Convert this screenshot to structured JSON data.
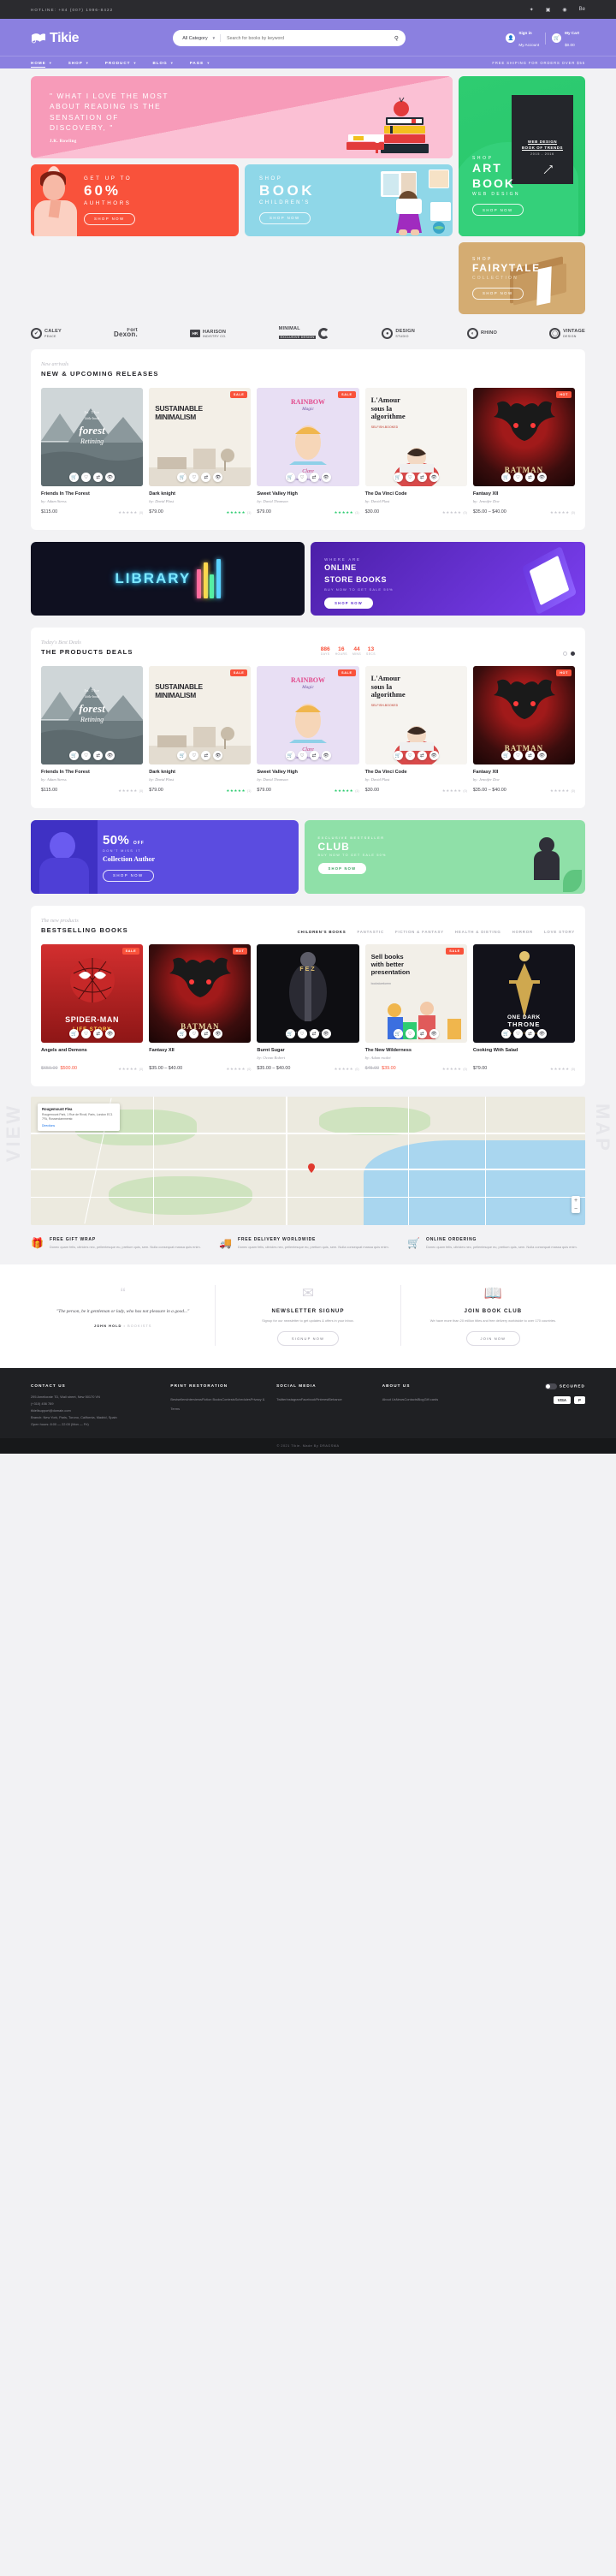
{
  "topbar": {
    "hotline": "HOTLINE: +84 (007) 1996-8422",
    "socials": [
      "twitter-icon",
      "instagram-icon",
      "dribbble-icon",
      "behance-icon"
    ],
    "social_glyphs": [
      "✓",
      "▣",
      "◉",
      "Be"
    ]
  },
  "header": {
    "logo_text": "Tikie",
    "category_label": "All Category",
    "search_placeholder": "Search for books by keyword",
    "account": {
      "line1": "Sign in",
      "line2": "My Account"
    },
    "cart": {
      "line1": "My Cart",
      "line2": "$0.00"
    }
  },
  "nav": {
    "items": [
      "HOME",
      "SHOP",
      "PRODUCT",
      "BLOG",
      "PAGE"
    ],
    "active": "HOME",
    "shipping_note": "FREE SHIPING FOR ORDERS OVER $55"
  },
  "hero": {
    "quote": {
      "lines": [
        "\" WHAT I LOVE THE MOST",
        "ABOUT READING IS THE",
        "SENSATION OF",
        "DISCOVERY, \""
      ],
      "author": "J.K. Rowling"
    },
    "red": {
      "t1": "GET UP TO",
      "t2": "60%",
      "t3": "AUHTHORS",
      "btn": "SHOP NOW"
    },
    "blue": {
      "t1": "SHOP",
      "t2": "BOOK",
      "t3": "CHILDREN'S",
      "btn": "SHOP NOW"
    },
    "green": {
      "t1": "SHOP",
      "t2_line1": "ART",
      "t2_line2": "BOOK",
      "t3": "WEB DESIGN",
      "btn": "SHOP NOW",
      "book_title_1": "WEB DESIGN",
      "book_title_2": "BOOK OF TRENDS",
      "book_years": "2015 - 2016"
    },
    "tan": {
      "t1": "SHOP",
      "t2": "FAIRYTALE",
      "t3": "COLLECTION",
      "btn": "SHOP NOW"
    }
  },
  "brands": [
    {
      "name": "CALEY",
      "sub": "PEACE",
      "icon": "shield-check-icon"
    },
    {
      "name": "Fort",
      "sub": "Dexon.",
      "icon": "wordmark-icon"
    },
    {
      "name": "HARISON",
      "sub": "INDISTRY CO.",
      "icon": "hr-badge-icon"
    },
    {
      "name": "MINIMAL",
      "sub": "EXCLUSIVE DESIGN",
      "icon": "c-mark-icon"
    },
    {
      "name": "DESIGN",
      "sub": "STUDIO",
      "icon": "pin-icon"
    },
    {
      "name": "RHINO",
      "sub": "",
      "icon": "rhino-icon"
    },
    {
      "name": "VINTAGE",
      "sub": "DESIGN",
      "icon": "ring-icon"
    }
  ],
  "new_releases": {
    "eyebrow": "New arrivals",
    "title": "NEW & UPCOMING RELEASES",
    "products": [
      {
        "name": "Friends In The Forest",
        "author": "by: Adam Stress",
        "price": "$115.00",
        "old_price": "",
        "rating": 5,
        "rating_color": "grey",
        "count": "(0)",
        "badge": "",
        "cover": "forest"
      },
      {
        "name": "Dark knight",
        "author": "by: David Plast",
        "price": "$79.00",
        "old_price": "",
        "rating": 5,
        "rating_color": "green",
        "count": "(1)",
        "badge": "SALE",
        "cover": "minimal"
      },
      {
        "name": "Sweet Valley High",
        "author": "by: David Thomson",
        "price": "$79.00",
        "old_price": "",
        "rating": 5,
        "rating_color": "green",
        "count": "(1)",
        "badge": "SALE",
        "cover": "rainbow"
      },
      {
        "name": "The Da Vinci Code",
        "author": "by: David Plast",
        "price": "$30.00",
        "old_price": "",
        "rating": 5,
        "rating_color": "grey",
        "count": "(0)",
        "badge": "",
        "cover": "lamour"
      },
      {
        "name": "Fantasy XII",
        "author": "by: Jennifer Doe",
        "price": "$35.00 – $40.00",
        "old_price": "",
        "rating": 5,
        "rating_color": "grey",
        "count": "(0)",
        "badge": "HOT",
        "cover": "batman"
      }
    ]
  },
  "promo_mid": {
    "library_text": "LIBRARY",
    "purple": {
      "t1": "WHERE ARE",
      "t2_line1": "ONLINE",
      "t2_line2": "STORE BOOKS",
      "t3": "BUY NOW TO GET SALE 50%",
      "btn": "SHOP NOW"
    }
  },
  "deals": {
    "eyebrow": "Today's Best Deals",
    "title": "THE PRODUCTS DEALS",
    "countdown": [
      {
        "num": "886",
        "lab": "DAYS"
      },
      {
        "num": "16",
        "lab": "HOURS"
      },
      {
        "num": "44",
        "lab": "MINS"
      },
      {
        "num": "13",
        "lab": "SECS"
      }
    ],
    "products": [
      {
        "name": "Friends In The Forest",
        "author": "by: Adam Stress",
        "price": "$115.00",
        "rating": 5,
        "rating_color": "grey",
        "count": "(0)",
        "badge": "",
        "cover": "forest"
      },
      {
        "name": "Dark knight",
        "author": "by: David Plast",
        "price": "$79.00",
        "rating": 5,
        "rating_color": "green",
        "count": "(1)",
        "badge": "SALE",
        "cover": "minimal"
      },
      {
        "name": "Sweet Valley High",
        "author": "by: David Thomson",
        "price": "$79.00",
        "rating": 5,
        "rating_color": "green",
        "count": "(1)",
        "badge": "SALE",
        "cover": "rainbow"
      },
      {
        "name": "The Da Vinci Code",
        "author": "by: David Plast",
        "price": "$30.00",
        "rating": 5,
        "rating_color": "grey",
        "count": "(0)",
        "badge": "",
        "cover": "lamour"
      },
      {
        "name": "Fantasy XII",
        "author": "by: Jennifer Doe",
        "price": "$35.00 – $40.00",
        "rating": 5,
        "rating_color": "grey",
        "count": "(0)",
        "badge": "HOT",
        "cover": "batman"
      }
    ]
  },
  "promo_bottom": {
    "indigo": {
      "percent": "50%",
      "off": "OFF",
      "t2": "DON'T MISS IT",
      "t3": "Collection Author",
      "btn": "SHOP NOW"
    },
    "mint": {
      "t1": "EXCLUSIVE BESTSELLER",
      "t2": "CLUB",
      "t3": "BUY NOW TO GET SALE 50%",
      "btn": "SHOP NOW"
    }
  },
  "bestselling": {
    "eyebrow": "The new products",
    "title": "BESTSELLING BOOKS",
    "tabs": [
      "CHILDREN'S BOOKS",
      "FANTASTIC",
      "FICTION & FANTASY",
      "HEALTH & DIETING",
      "HORROR",
      "LOVE STORY"
    ],
    "active_tab": "CHILDREN'S BOOKS",
    "products": [
      {
        "name": "Angels and Demons",
        "author": "",
        "price": "$500.00",
        "old_price": "$650.00",
        "rating": 5,
        "rating_color": "grey",
        "count": "(0)",
        "badge": "SALE",
        "cover": "spiderman"
      },
      {
        "name": "Fantasy XII",
        "author": "",
        "price": "$35.00 – $40.00",
        "old_price": "",
        "rating": 5,
        "rating_color": "grey",
        "count": "(0)",
        "badge": "HOT",
        "cover": "batman"
      },
      {
        "name": "Burnt Sugar",
        "author": "by: Ocean Robert",
        "price": "$35.00 – $40.00",
        "old_price": "",
        "rating": 5,
        "rating_color": "grey",
        "count": "(0)",
        "badge": "",
        "cover": "fez"
      },
      {
        "name": "The New Wilderness",
        "author": "by: Adam rocket",
        "price": "$39.00",
        "old_price": "$45.00",
        "rating": 5,
        "rating_color": "grey",
        "count": "(0)",
        "badge": "SALE",
        "cover": "sellbooks"
      },
      {
        "name": "Cooking With Salad",
        "author": "",
        "price": "$79.00",
        "old_price": "",
        "rating": 5,
        "rating_color": "grey",
        "count": "(0)",
        "badge": "",
        "cover": "throne"
      }
    ]
  },
  "map": {
    "side_left": "VIEW",
    "side_right": "MAP",
    "card_title": "Rougemount Flea",
    "card_lines": "Rougemount Park, 1 Rue de Rivoli, Paris, London EC1 7FA, Rossendammerstr.",
    "card_sub": "Leave review",
    "card_link": "Directions",
    "zoom_in": "+",
    "zoom_out": "−"
  },
  "features": [
    {
      "icon": "gift-icon",
      "title": "FREE GIFT WRAP",
      "desc": "Donec quam felis, ultricies nec, pellentesque eu, pretium quis, sem. Nulla consequat massa quis enim."
    },
    {
      "icon": "truck-icon",
      "title": "FREE DELIVERY WORLDWIDE",
      "desc": "Donec quam felis, ultricies nec, pellentesque eu, pretium quis, sem. Nulla consequat massa quis enim."
    },
    {
      "icon": "basket-icon",
      "title": "ONLINE ORDERING",
      "desc": "Donec quam felis, ultricies nec, pellentesque eu, pretium quis, sem. Nulla consequat massa quis enim."
    }
  ],
  "cta3": [
    {
      "icon": "quote-icon",
      "quote": "\"The person, be it gentleman or lady, who has not pleasure in a good...\"",
      "author": "JOHN HOLD",
      "author_sub": "• BOOKISTS",
      "title": "",
      "desc": "",
      "button": ""
    },
    {
      "icon": "envelope-icon",
      "quote": "",
      "author": "",
      "author_sub": "",
      "title": "NEWSLETTER SIGNUP",
      "desc": "Signup for our newsletter to get updates & offers in your inbox.",
      "button": "SIGNUP NOW"
    },
    {
      "icon": "book-icon",
      "quote": "",
      "author": "",
      "author_sub": "",
      "title": "JOIN BOOK CLUB",
      "desc": "We have more than 20 million titles and free delivery worldwide to over 170 countries.",
      "button": "JOIN NOW"
    }
  ],
  "footer": {
    "columns": [
      {
        "heading": "CONTACT US",
        "lines": [
          "295 Ameliorate TD, Wall street, New 50170 VN",
          "(+310) 456 789",
          "tikiellsupport@domain.com",
          "Branch: New York, Paris, Torono, California, Madrid, Spain",
          "Open hours: 8:00 — 22:00 (Mon — Fri)"
        ]
      },
      {
        "heading": "PRINT RESTORATION",
        "lines": [
          "Bestsellers",
          "Interviews",
          "Fiction Books",
          "Contests",
          "Schedules",
          "Privacy & Terms"
        ]
      },
      {
        "heading": "SOCIAL MEDIA",
        "lines": [
          "Twitter",
          "Instagram",
          "Facebook",
          "Pinterest",
          "Behance"
        ]
      },
      {
        "heading": "ABOUT US",
        "lines": [
          "About Us",
          "News",
          "Contacts",
          "Blog",
          "Gift cards"
        ]
      }
    ],
    "payment_label": "SECURED",
    "payment_chips": [
      "VISA",
      "P"
    ],
    "copyright": "© 2021 Tikie. Made By DRAGSMA"
  }
}
